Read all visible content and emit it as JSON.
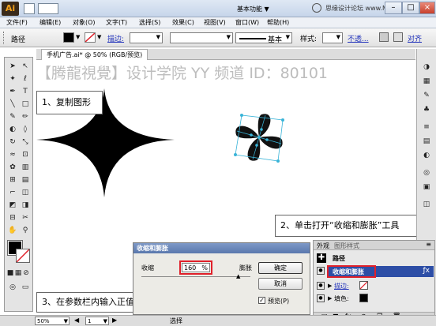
{
  "titlebar": {
    "logo": "Ai",
    "workspace": "基本功能 ▼",
    "watermark": "思缘设计论坛 www.MISSYUAN.COM"
  },
  "menu": [
    "文件(F)",
    "编辑(E)",
    "对象(O)",
    "文字(T)",
    "选择(S)",
    "效果(C)",
    "视图(V)",
    "窗口(W)",
    "帮助(H)"
  ],
  "control": {
    "selection_label": "路径",
    "stroke_label": "描边:",
    "basic_label": "基本",
    "style_label": "样式:",
    "opacity_label": "不透...",
    "align_label": "对齐"
  },
  "document": {
    "tab": "手机广告.ai* @ 50% (RGB/预览)",
    "watermark": "【腾龍視覺】设计学院 YY 频道 ID：80101"
  },
  "callouts": {
    "step1": "1、复制图形",
    "step2": "2、单击打开“收缩和膨胀”工具",
    "step3": "3、在参数栏内输入正值，将图形膨胀"
  },
  "dialog": {
    "title": "收缩和膨胀",
    "left_label": "收缩",
    "value": "160",
    "unit": "%",
    "right_label": "膨胀",
    "ok": "确定",
    "cancel": "取消",
    "preview": "预览(P)",
    "preview_checked": true
  },
  "layers": {
    "tabs": [
      "外观",
      "图形样式"
    ],
    "path_label": "路径",
    "effect_item": "收缩和膨胀",
    "stroke_label": "描边:",
    "fill_label": "填色:"
  },
  "status": {
    "zoom": "50%",
    "page": "1",
    "mode": "选择"
  },
  "colors": {
    "highlight": "#e0202a",
    "dialog_title": "#5a78ad",
    "selection": "#3ab4d8"
  }
}
